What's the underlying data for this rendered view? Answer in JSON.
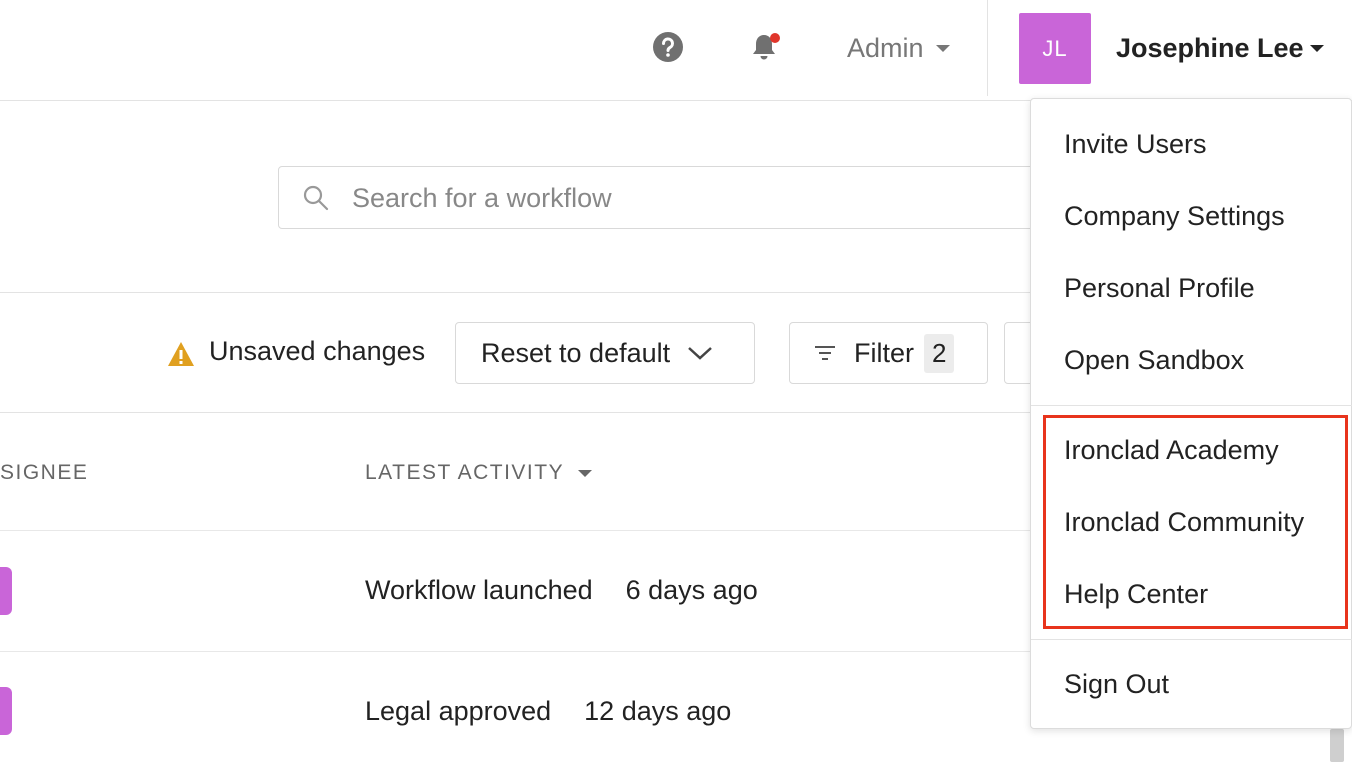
{
  "header": {
    "help_icon": "question-circle-icon",
    "bell_icon": "bell-icon",
    "notification_dot_color": "#e0352b",
    "admin_label": "Admin",
    "avatar_initials": "JL",
    "avatar_color": "#c965d8",
    "user_name": "Josephine Lee"
  },
  "search": {
    "placeholder": "Search for a workflow",
    "value": ""
  },
  "toolbar": {
    "unsaved_label": "Unsaved changes",
    "reset_label": "Reset to default",
    "filter_label": "Filter",
    "filter_count": "2"
  },
  "table": {
    "columns": [
      "SIGNEE",
      "LATEST ACTIVITY"
    ],
    "rows": [
      {
        "activity": "Workflow launched",
        "time": "6 days ago"
      },
      {
        "activity": "Legal approved",
        "time": "12 days ago"
      }
    ]
  },
  "user_menu": {
    "items": [
      "Invite Users",
      "Company Settings",
      "Personal Profile",
      "Open Sandbox"
    ],
    "resources": [
      "Ironclad Academy",
      "Ironclad Community",
      "Help Center"
    ],
    "sign_out": "Sign Out",
    "highlight_color": "#e8341c"
  }
}
